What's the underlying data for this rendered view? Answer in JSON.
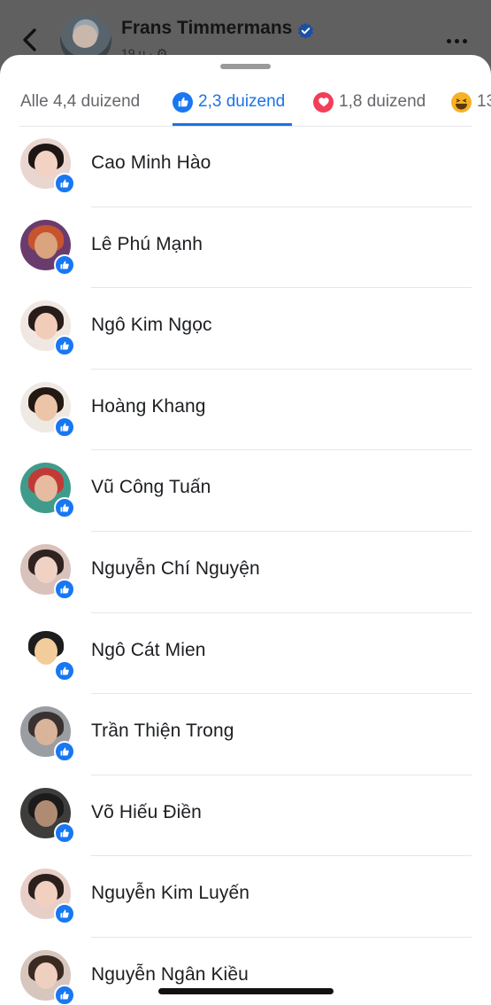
{
  "post": {
    "author_name": "Frans Timmermans",
    "meta": "19 u · ⚙"
  },
  "tabs": [
    {
      "label": "Alle 4,4 duizend",
      "icon": null
    },
    {
      "label": "2,3 duizend",
      "icon": "like-reaction-icon"
    },
    {
      "label": "1,8 duizend",
      "icon": "love-reaction-icon"
    },
    {
      "label": "13",
      "icon": "haha-reaction-icon"
    }
  ],
  "colors": {
    "accent": "#1b74e4",
    "like": "#1877f2",
    "love": "#f33e58",
    "haha": "#f7b125"
  },
  "people": [
    {
      "name": "Cao Minh Hào",
      "avatar_colors": [
        "#e9d6d0",
        "#f2d2c2",
        "#1e1614"
      ]
    },
    {
      "name": "Lê Phú Mạnh",
      "avatar_colors": [
        "#6a3c6e",
        "#d9a47e",
        "#c8542f"
      ]
    },
    {
      "name": "Ngô Kim Ngọc",
      "avatar_colors": [
        "#f0e6e2",
        "#f1cdb9",
        "#271c19"
      ]
    },
    {
      "name": "Hoàng Khang",
      "avatar_colors": [
        "#efe9e4",
        "#ecc4a8",
        "#241812"
      ]
    },
    {
      "name": "Vũ Công Tuấn",
      "avatar_colors": [
        "#3f9c8c",
        "#e6bba0",
        "#c23a36"
      ]
    },
    {
      "name": "Nguyễn Chí Nguyện",
      "avatar_colors": [
        "#d8c2bb",
        "#efd2c4",
        "#2f2220"
      ]
    },
    {
      "name": "Ngô Cát Mien",
      "avatar_colors": [
        "#ffffff",
        "#f2cc9a",
        "#1d1d1d"
      ]
    },
    {
      "name": "Trần Thiện Trong",
      "avatar_colors": [
        "#9a9ea3",
        "#d8b49a",
        "#3a3230"
      ]
    },
    {
      "name": "Võ Hiếu Điền",
      "avatar_colors": [
        "#3e3d3c",
        "#b08b74",
        "#1b1b1b"
      ]
    },
    {
      "name": "Nguyễn Kim Luyến",
      "avatar_colors": [
        "#e7cfc8",
        "#f2d0c0",
        "#2c201c"
      ]
    },
    {
      "name": "Nguyễn Ngân Kiều",
      "avatar_colors": [
        "#d6c6bd",
        "#efcfbf",
        "#3b2a22"
      ]
    }
  ]
}
